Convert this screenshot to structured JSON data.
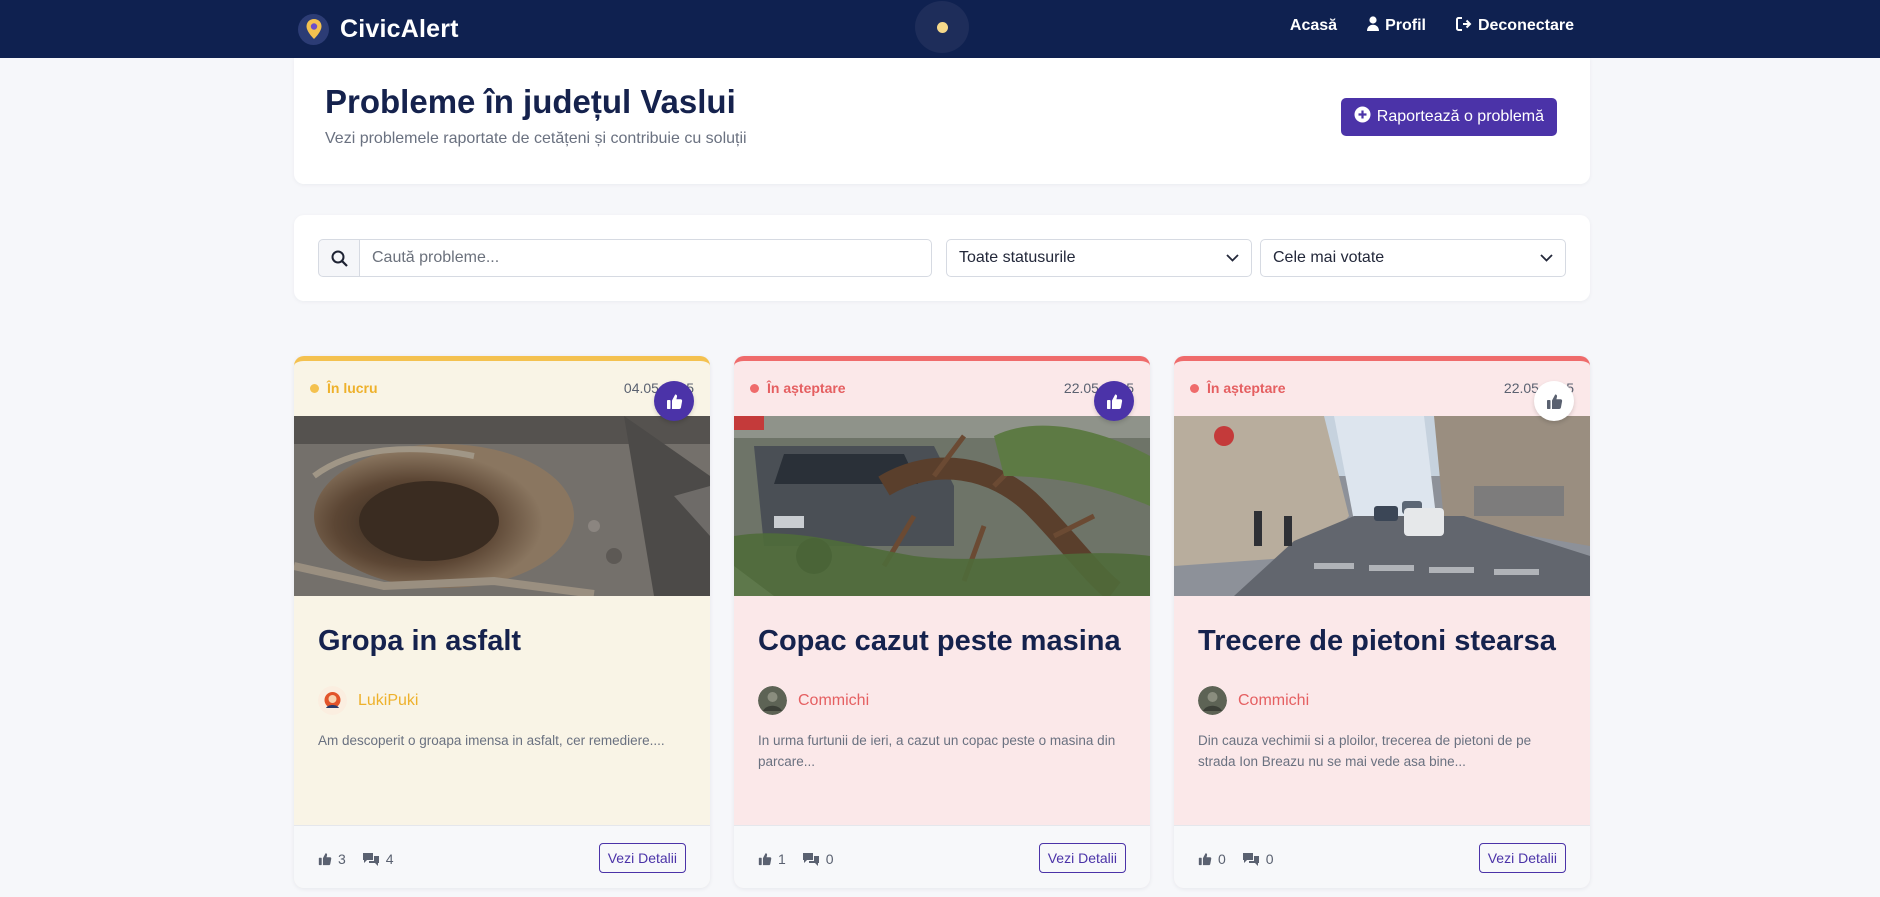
{
  "navbar": {
    "brand": "CivicAlert",
    "links": [
      {
        "label": "Acasă",
        "icon": "none"
      },
      {
        "label": "Profil",
        "icon": "user-icon"
      },
      {
        "label": "Deconectare",
        "icon": "logout-icon"
      }
    ]
  },
  "header": {
    "title": "Probleme în județul Vaslui",
    "subtitle": "Vezi problemele raportate de cetățeni și contribuie cu soluții",
    "report_button": "Raportează o problemă"
  },
  "filters": {
    "search_placeholder": "Caută probleme...",
    "status_select": "Toate statusurile",
    "sort_select": "Cele mai votate"
  },
  "cards": [
    {
      "status": "În lucru",
      "date": "04.05.2025",
      "title": "Gropa in asfalt",
      "author": "LukiPuki",
      "excerpt": "Am descoperit o groapa imensa in asfalt, cer remediere....",
      "likes": "3",
      "comments": "4",
      "details_label": "Vezi Detalii"
    },
    {
      "status": "În așteptare",
      "date": "22.05.2025",
      "title": "Copac cazut peste masina",
      "author": "Commichi",
      "excerpt": "In urma furtunii de ieri, a cazut un copac peste o masina din parcare...",
      "likes": "1",
      "comments": "0",
      "details_label": "Vezi Detalii"
    },
    {
      "status": "În așteptare",
      "date": "22.05.2025",
      "title": "Trecere de pietoni stearsa",
      "author": "Commichi",
      "excerpt": "Din cauza vechimii si a ploilor, trecerea de pietoni de pe strada Ion Breazu nu se mai vede asa bine...",
      "likes": "0",
      "comments": "0",
      "details_label": "Vezi Detalii"
    }
  ],
  "colors": {
    "navbar": "#0f2150",
    "accent": "#4b33a8",
    "status_in_progress": "#f4c14f",
    "status_pending": "#ef6b6b"
  }
}
